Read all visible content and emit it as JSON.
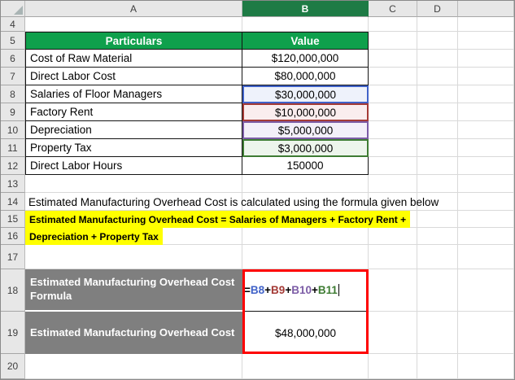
{
  "sheet": {
    "column_headers": [
      "A",
      "B",
      "C",
      "D"
    ],
    "selected_column": "B",
    "row_numbers": [
      "4",
      "5",
      "6",
      "7",
      "8",
      "9",
      "10",
      "11",
      "12",
      "13",
      "14",
      "15",
      "16",
      "17",
      "18",
      "19",
      "20"
    ]
  },
  "overhead_table": {
    "headers": {
      "particulars": "Particulars",
      "value": "Value"
    },
    "rows": [
      {
        "label": "Cost of Raw Material",
        "value": "$120,000,000",
        "ref_highlight": "none"
      },
      {
        "label": "Direct Labor Cost",
        "value": "$80,000,000",
        "ref_highlight": "none"
      },
      {
        "label": "Salaries of Floor Managers",
        "value": "$30,000,000",
        "ref_highlight": "blue"
      },
      {
        "label": "Factory Rent",
        "value": "$10,000,000",
        "ref_highlight": "red"
      },
      {
        "label": "Depreciation",
        "value": "$5,000,000",
        "ref_highlight": "purple"
      },
      {
        "label": "Property Tax",
        "value": "$3,000,000",
        "ref_highlight": "green"
      },
      {
        "label": "Direct Labor Hours",
        "value": "150000",
        "ref_highlight": "none"
      }
    ]
  },
  "description_line": "Estimated Manufacturing Overhead Cost is calculated using the formula given below",
  "highlight_formula": {
    "line1": "Estimated Manufacturing Overhead Cost = Salaries of Managers + Factory Rent +",
    "line2": "Depreciation + Property Tax"
  },
  "result_section": {
    "formula_row_label": "Estimated Manufacturing Overhead Cost Formula",
    "formula_parts": [
      {
        "text": "=",
        "role": "operator"
      },
      {
        "text": "B8",
        "role": "ref-blue"
      },
      {
        "text": "+",
        "role": "operator"
      },
      {
        "text": "B9",
        "role": "ref-red"
      },
      {
        "text": "+",
        "role": "operator"
      },
      {
        "text": "B10",
        "role": "ref-purple"
      },
      {
        "text": "+",
        "role": "operator"
      },
      {
        "text": "B11",
        "role": "ref-green"
      }
    ],
    "cost_row_label": "Estimated Manufacturing Overhead Cost",
    "cost_value": "$48,000,000"
  },
  "colors": {
    "table_header_green": "#0FA04C",
    "selected_column_green": "#1E7B45",
    "highlight_yellow": "#FFFF00",
    "label_gray": "#7F7F7F",
    "selection_red": "#FF0000",
    "ref_blue": "#4062C8",
    "ref_red": "#A43A36",
    "ref_purple": "#7C5CA6",
    "ref_green": "#3E7C33"
  }
}
